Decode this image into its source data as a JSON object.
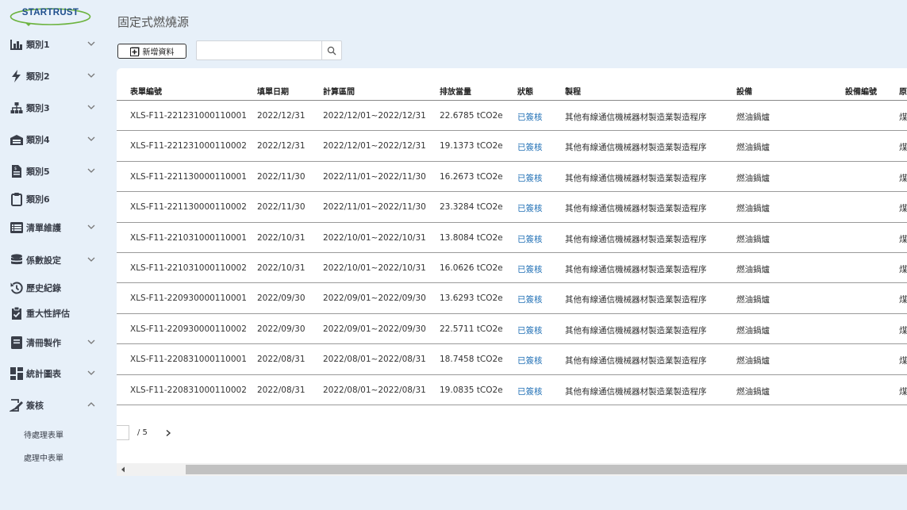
{
  "brand": {
    "logo_text": "STARTRUST",
    "color": "#1f4e8c",
    "swoosh_color": "#6cb33f"
  },
  "sidebar": {
    "items": [
      {
        "label": "類別1",
        "icon": "bar-chart-icon",
        "chevron": "down"
      },
      {
        "label": "類別2",
        "icon": "lightning-icon",
        "chevron": "down"
      },
      {
        "label": "類別3",
        "icon": "sitemap-icon",
        "chevron": "down"
      },
      {
        "label": "類別4",
        "icon": "warehouse-icon",
        "chevron": "down"
      },
      {
        "label": "類別5",
        "icon": "file-invoice-icon",
        "chevron": "down"
      },
      {
        "label": "類別6",
        "icon": "clipboard-icon",
        "chevron": ""
      },
      {
        "label": "清單維護",
        "icon": "list-icon",
        "chevron": "down"
      },
      {
        "label": "係數設定",
        "icon": "database-icon",
        "chevron": "down"
      },
      {
        "label": "歷史紀錄",
        "icon": "history-icon",
        "chevron": ""
      },
      {
        "label": "重大性評估",
        "icon": "clipboard-check-icon",
        "chevron": ""
      },
      {
        "label": "清冊製作",
        "icon": "book-icon",
        "chevron": "down"
      },
      {
        "label": "統計圖表",
        "icon": "dashboard-icon",
        "chevron": "down"
      },
      {
        "label": "簽核",
        "icon": "signature-icon",
        "chevron": "up"
      }
    ],
    "sub_items": [
      "待處理表單",
      "處理中表單"
    ]
  },
  "header": {
    "title": "固定式燃燒源",
    "add_button_label": "新增資料",
    "search_placeholder": "",
    "search_value": ""
  },
  "table": {
    "columns": [
      "表單編號",
      "填單日期",
      "計算區間",
      "排放當量",
      "狀態",
      "製程",
      "設備",
      "設備編號",
      "原"
    ],
    "rows": [
      [
        "XLS-F11-221231000110001",
        "2022/12/31",
        "2022/12/01~2022/12/31",
        "22.6785 tCO2e",
        "已簽核",
        "其他有線通信機械器材製造業製造程序",
        "燃油鍋爐",
        "",
        "煤"
      ],
      [
        "XLS-F11-221231000110002",
        "2022/12/31",
        "2022/12/01~2022/12/31",
        "19.1373 tCO2e",
        "已簽核",
        "其他有線通信機械器材製造業製造程序",
        "燃油鍋爐",
        "",
        "煤"
      ],
      [
        "XLS-F11-221130000110001",
        "2022/11/30",
        "2022/11/01~2022/11/30",
        "16.2673 tCO2e",
        "已簽核",
        "其他有線通信機械器材製造業製造程序",
        "燃油鍋爐",
        "",
        "煤"
      ],
      [
        "XLS-F11-221130000110002",
        "2022/11/30",
        "2022/11/01~2022/11/30",
        "23.3284 tCO2e",
        "已簽核",
        "其他有線通信機械器材製造業製造程序",
        "燃油鍋爐",
        "",
        "煤"
      ],
      [
        "XLS-F11-221031000110001",
        "2022/10/31",
        "2022/10/01~2022/10/31",
        "13.8084 tCO2e",
        "已簽核",
        "其他有線通信機械器材製造業製造程序",
        "燃油鍋爐",
        "",
        "煤"
      ],
      [
        "XLS-F11-221031000110002",
        "2022/10/31",
        "2022/10/01~2022/10/31",
        "16.0626 tCO2e",
        "已簽核",
        "其他有線通信機械器材製造業製造程序",
        "燃油鍋爐",
        "",
        "煤"
      ],
      [
        "XLS-F11-220930000110001",
        "2022/09/30",
        "2022/09/01~2022/09/30",
        "13.6293 tCO2e",
        "已簽核",
        "其他有線通信機械器材製造業製造程序",
        "燃油鍋爐",
        "",
        "煤"
      ],
      [
        "XLS-F11-220930000110002",
        "2022/09/30",
        "2022/09/01~2022/09/30",
        "22.5711 tCO2e",
        "已簽核",
        "其他有線通信機械器材製造業製造程序",
        "燃油鍋爐",
        "",
        "煤"
      ],
      [
        "XLS-F11-220831000110001",
        "2022/08/31",
        "2022/08/01~2022/08/31",
        "18.7458 tCO2e",
        "已簽核",
        "其他有線通信機械器材製造業製造程序",
        "燃油鍋爐",
        "",
        "煤"
      ],
      [
        "XLS-F11-220831000110002",
        "2022/08/31",
        "2022/08/01~2022/08/31",
        "19.0835 tCO2e",
        "已簽核",
        "其他有線通信機械器材製造業製造程序",
        "燃油鍋爐",
        "",
        "煤"
      ]
    ]
  },
  "pagination": {
    "current": "",
    "total_label": "/ 5"
  },
  "colors": {
    "background": "#e7f0f9",
    "status_link": "#1f6fb5"
  }
}
